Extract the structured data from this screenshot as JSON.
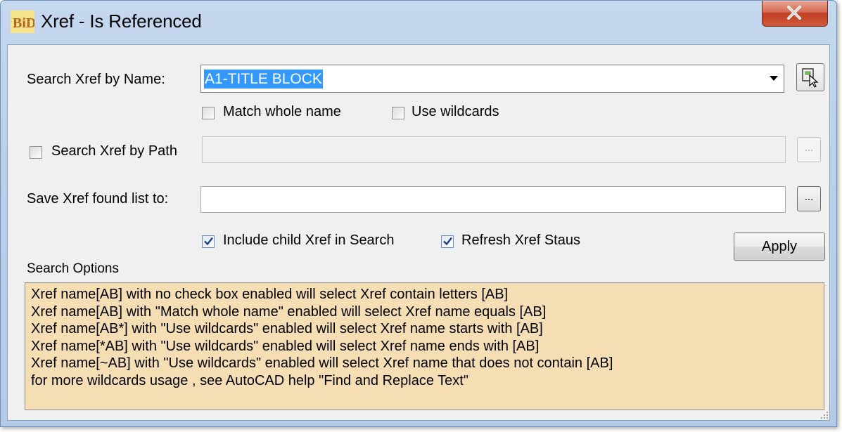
{
  "window": {
    "title": "Xref - Is Referenced",
    "icon_text": "BiD",
    "close_label": "x"
  },
  "search_name": {
    "label": "Search Xref by Name:",
    "value": "A1-TITLE BLOCK"
  },
  "match_whole_name": {
    "label": "Match whole name",
    "checked": false
  },
  "use_wildcards": {
    "label": "Use wildcards",
    "checked": false
  },
  "search_path": {
    "label": "Search Xref by Path",
    "checked": false,
    "value": "",
    "browse_label": "..."
  },
  "save_list": {
    "label": "Save Xref found list to:",
    "value": "",
    "browse_label": "..."
  },
  "include_child": {
    "label": "Include child Xref in Search",
    "checked": true
  },
  "refresh_status": {
    "label": "Refresh Xref Staus",
    "checked": true
  },
  "apply_label": "Apply",
  "search_options": {
    "label": "Search Options",
    "lines": [
      "Xref name[AB] with no check box enabled will select Xref contain letters [AB]",
      "Xref name[AB] with \"Match whole name\" enabled will select Xref name equals [AB]",
      "Xref name[AB*] with \"Use wildcards\" enabled will select Xref name starts with [AB]",
      "Xref name[*AB] with \"Use wildcards\" enabled will select Xref name ends with [AB]",
      "Xref name[~AB] with \"Use wildcards\" enabled will select Xref name that does not contain [AB]",
      "for more wildcards usage , see AutoCAD help  \"Find and Replace Text\""
    ]
  },
  "colors": {
    "options_bg": "#f5deb3",
    "selection": "#3399ff",
    "titlebar": "#b9cfea",
    "close_button": "#c03f22"
  }
}
